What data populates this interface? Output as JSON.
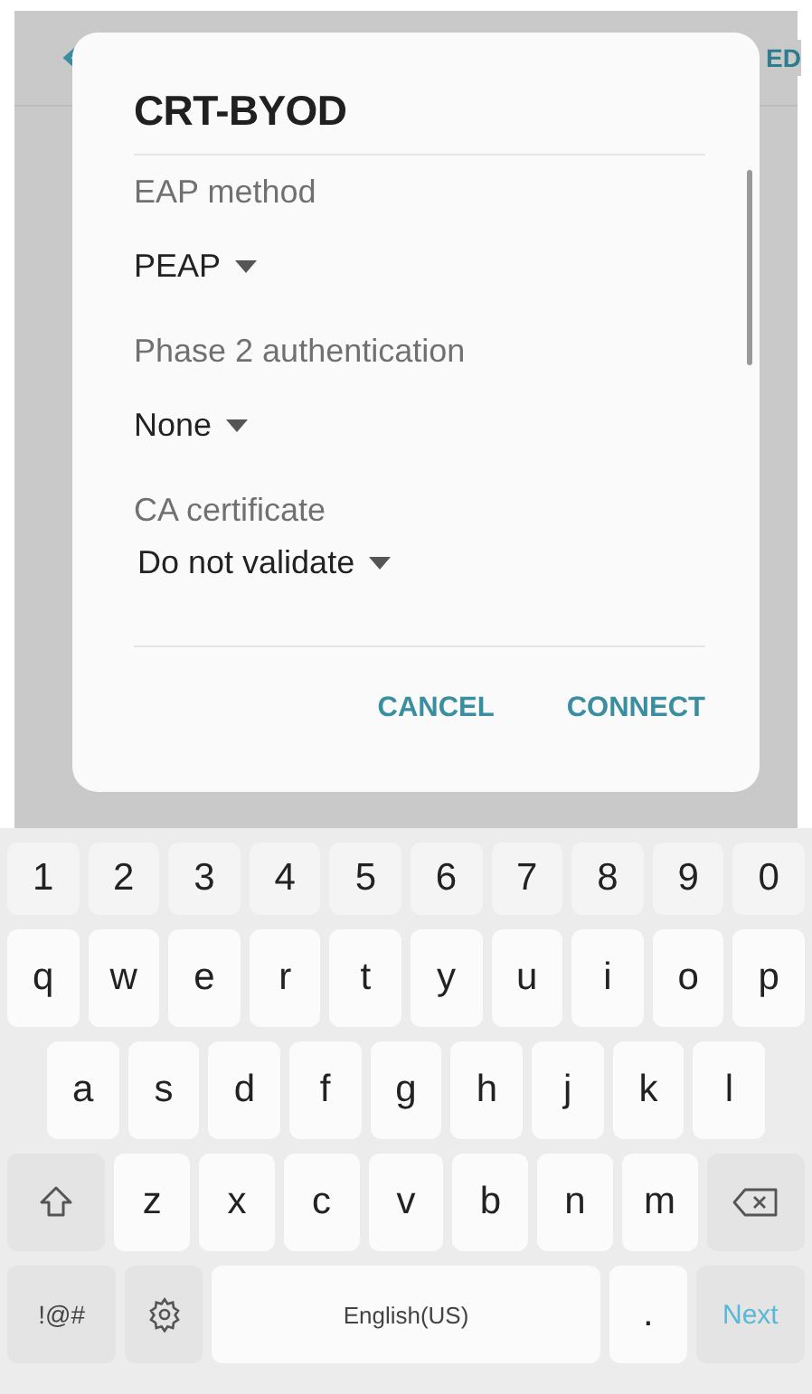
{
  "background": {
    "action_text": "ED"
  },
  "dialog": {
    "title": "CRT-BYOD",
    "fields": [
      {
        "label": "EAP method",
        "value": "PEAP"
      },
      {
        "label": "Phase 2 authentication",
        "value": "None"
      },
      {
        "label": "CA certificate",
        "value": "Do not validate"
      }
    ],
    "buttons": [
      "CANCEL",
      "CONNECT"
    ]
  },
  "keyboard": {
    "rows": [
      {
        "keys": [
          {
            "kind": "num",
            "label": "1"
          },
          {
            "kind": "num",
            "label": "2"
          },
          {
            "kind": "num",
            "label": "3"
          },
          {
            "kind": "num",
            "label": "4"
          },
          {
            "kind": "num",
            "label": "5"
          },
          {
            "kind": "num",
            "label": "6"
          },
          {
            "kind": "num",
            "label": "7"
          },
          {
            "kind": "num",
            "label": "8"
          },
          {
            "kind": "num",
            "label": "9"
          },
          {
            "kind": "num",
            "label": "0"
          }
        ]
      },
      {
        "keys": [
          {
            "kind": "char",
            "label": "q"
          },
          {
            "kind": "char",
            "label": "w"
          },
          {
            "kind": "char",
            "label": "e"
          },
          {
            "kind": "char",
            "label": "r"
          },
          {
            "kind": "char",
            "label": "t"
          },
          {
            "kind": "char",
            "label": "y"
          },
          {
            "kind": "char",
            "label": "u"
          },
          {
            "kind": "char",
            "label": "i"
          },
          {
            "kind": "char",
            "label": "o"
          },
          {
            "kind": "char",
            "label": "p"
          }
        ]
      },
      {
        "keys": [
          {
            "kind": "char",
            "label": "a"
          },
          {
            "kind": "char",
            "label": "s"
          },
          {
            "kind": "char",
            "label": "d"
          },
          {
            "kind": "char",
            "label": "f"
          },
          {
            "kind": "char",
            "label": "g"
          },
          {
            "kind": "char",
            "label": "h"
          },
          {
            "kind": "char",
            "label": "j"
          },
          {
            "kind": "char",
            "label": "k"
          },
          {
            "kind": "char",
            "label": "l"
          }
        ]
      },
      {
        "keys": [
          {
            "kind": "shift"
          },
          {
            "kind": "char",
            "label": "z"
          },
          {
            "kind": "char",
            "label": "x"
          },
          {
            "kind": "char",
            "label": "c"
          },
          {
            "kind": "char",
            "label": "v"
          },
          {
            "kind": "char",
            "label": "b"
          },
          {
            "kind": "char",
            "label": "n"
          },
          {
            "kind": "char",
            "label": "m"
          },
          {
            "kind": "backspace"
          }
        ]
      },
      {
        "keys": [
          {
            "kind": "symbols",
            "label": "!@#"
          },
          {
            "kind": "settings"
          },
          {
            "kind": "space",
            "label": "English(US)"
          },
          {
            "kind": "char",
            "label": "."
          },
          {
            "kind": "action",
            "label": "Next"
          }
        ]
      }
    ]
  }
}
